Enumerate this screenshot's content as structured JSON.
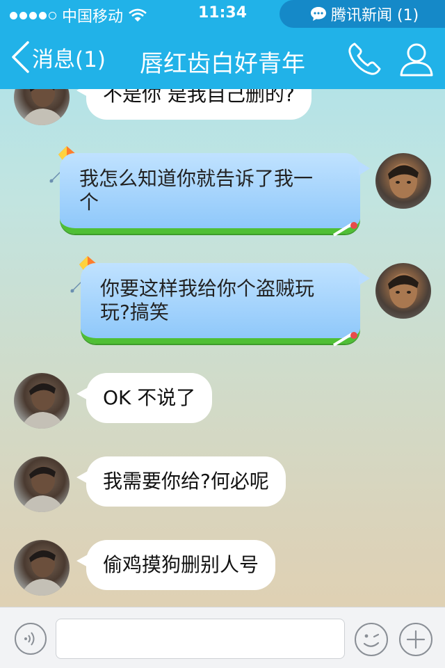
{
  "status_bar": {
    "carrier": "中国移动",
    "time": "11:34",
    "notification": "腾讯新闻 (1)"
  },
  "nav": {
    "back_label": "消息(1)",
    "title": "唇红齿白好青年"
  },
  "messages": [
    {
      "sender": "friend",
      "text": "不是你 是我自己删的?"
    },
    {
      "sender": "me",
      "line1": "我怎么知道你就告诉了我一",
      "line2": "个"
    },
    {
      "sender": "me",
      "line1": "你要这样我给你个盗贼玩",
      "line2": "玩?搞笑"
    },
    {
      "sender": "friend",
      "text": "OK 不说了"
    },
    {
      "sender": "friend",
      "text": "我需要你给?何必呢"
    },
    {
      "sender": "friend",
      "text": "偷鸡摸狗删别人号"
    }
  ],
  "input": {
    "value": "",
    "placeholder": ""
  },
  "colors": {
    "header": "#21b2e8",
    "notification_pill": "#1589c8",
    "bubble_me": "#a8d5fd",
    "bubble_me_border": "#4fbf35",
    "bubble_friend": "#ffffff"
  },
  "icons": [
    "wifi-icon",
    "news-icon",
    "back-chevron-icon",
    "phone-icon",
    "profile-icon",
    "voice-icon",
    "emoji-icon",
    "plus-icon",
    "kite-icon"
  ]
}
